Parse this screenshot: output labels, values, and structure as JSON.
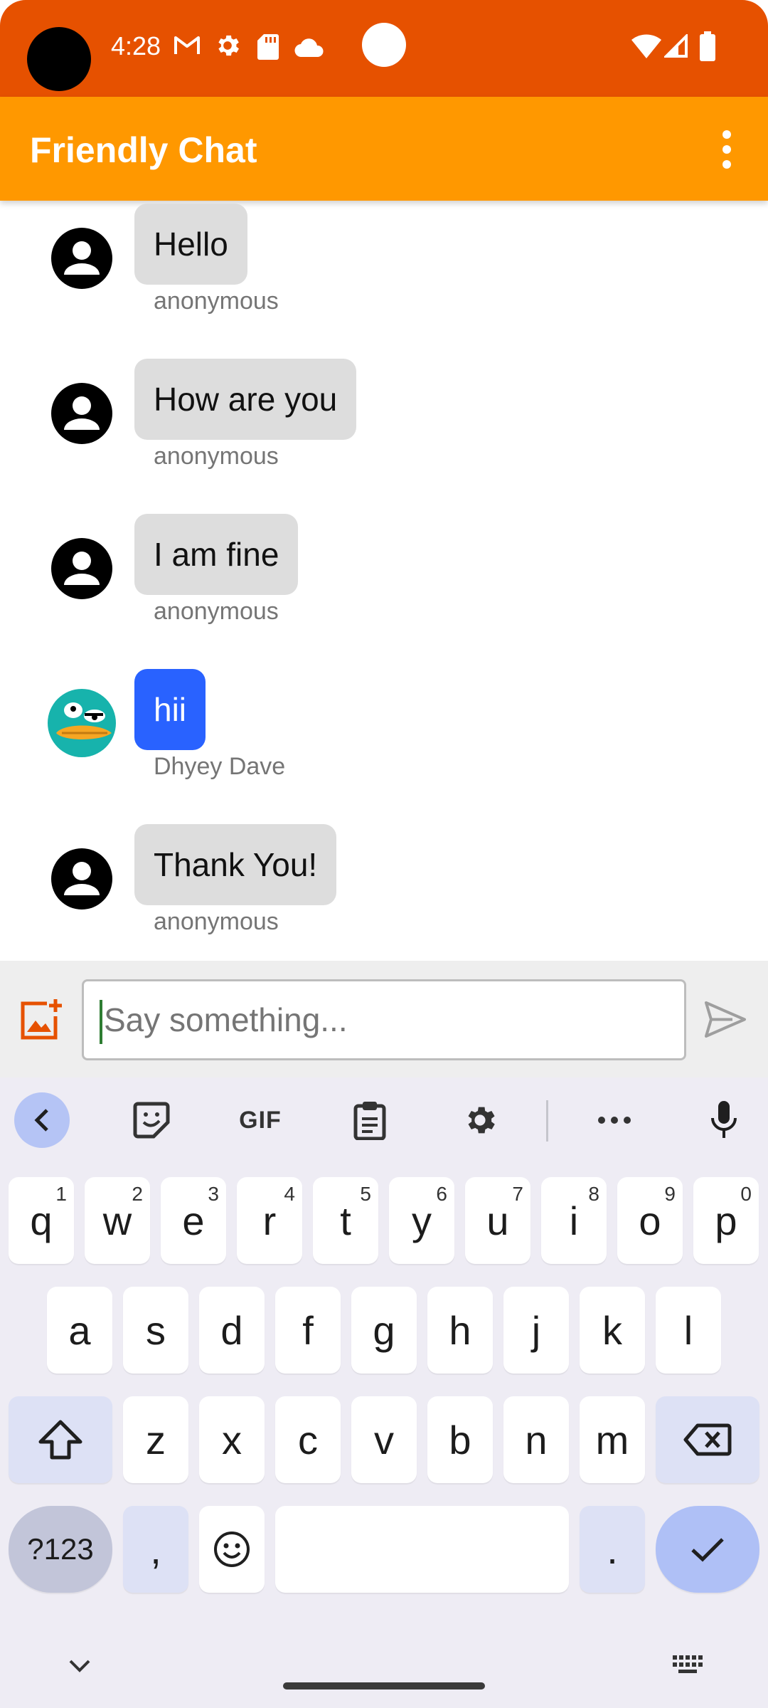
{
  "status_bar": {
    "time": "4:28",
    "left_icons": [
      "gmail-icon",
      "settings-icon",
      "sd-card-icon",
      "cloud-icon"
    ],
    "right_icons": [
      "wifi-icon",
      "signal-icon",
      "battery-icon"
    ]
  },
  "app_bar": {
    "title": "Friendly Chat",
    "menu_icon": "more-vert-icon"
  },
  "messages": [
    {
      "text": "Hello",
      "sender": "anonymous",
      "avatar": "default-person"
    },
    {
      "text": "How are you",
      "sender": "anonymous",
      "avatar": "default-person"
    },
    {
      "text": "I am fine",
      "sender": "anonymous",
      "avatar": "default-person"
    },
    {
      "text": "hii",
      "sender": "Dhyey Dave",
      "avatar": "platypus-photo"
    },
    {
      "text": "Thank You!",
      "sender": "anonymous",
      "avatar": "default-person"
    }
  ],
  "composer": {
    "placeholder": "Say something...",
    "value": "",
    "add_image_icon": "add-photo-icon",
    "send_icon": "send-icon"
  },
  "keyboard": {
    "toolbar": {
      "gif_label": "GIF",
      "items": [
        "back-icon",
        "sticker-icon",
        "gif",
        "clipboard-icon",
        "settings-icon",
        "more-icon",
        "mic-icon"
      ]
    },
    "row1": [
      {
        "label": "q",
        "hint": "1"
      },
      {
        "label": "w",
        "hint": "2"
      },
      {
        "label": "e",
        "hint": "3"
      },
      {
        "label": "r",
        "hint": "4"
      },
      {
        "label": "t",
        "hint": "5"
      },
      {
        "label": "y",
        "hint": "6"
      },
      {
        "label": "u",
        "hint": "7"
      },
      {
        "label": "i",
        "hint": "8"
      },
      {
        "label": "o",
        "hint": "9"
      },
      {
        "label": "p",
        "hint": "0"
      }
    ],
    "row2": [
      "a",
      "s",
      "d",
      "f",
      "g",
      "h",
      "j",
      "k",
      "l"
    ],
    "row3": [
      "z",
      "x",
      "c",
      "v",
      "b",
      "n",
      "m"
    ],
    "row4": {
      "symbols": "?123",
      "comma": ",",
      "period": "."
    }
  },
  "colors": {
    "status_bar": "#E65100",
    "app_bar": "#FF9800",
    "bubble": "#DDDDDD",
    "my_bubble": "#2962FF",
    "keyboard_bg": "#EEECF4"
  }
}
